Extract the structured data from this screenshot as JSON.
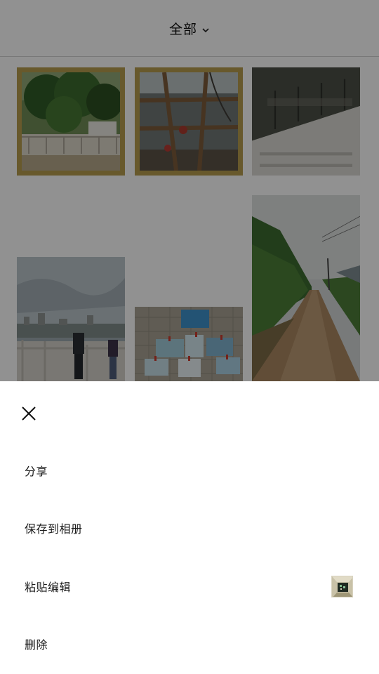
{
  "header": {
    "album_label": "全部"
  },
  "icons": {
    "dropdown": "chevron-down-icon",
    "close": "close-icon"
  },
  "photos": [
    {
      "name": "photo-tree-railing",
      "selected": true
    },
    {
      "name": "photo-window-bars",
      "selected": true
    },
    {
      "name": "photo-building-wall",
      "selected": false
    },
    {
      "name": "photo-viewpoint-people",
      "selected": false
    },
    {
      "name": "photo-postcard-wall",
      "selected": false
    },
    {
      "name": "photo-dirt-road",
      "selected": false
    }
  ],
  "sheet": {
    "items": [
      {
        "label": "分享"
      },
      {
        "label": "保存到相册"
      },
      {
        "label": "粘贴编辑"
      },
      {
        "label": "删除"
      }
    ]
  },
  "colors": {
    "selection_border": "#b39a4c",
    "overlay": "rgba(0,0,0,0.42)"
  }
}
